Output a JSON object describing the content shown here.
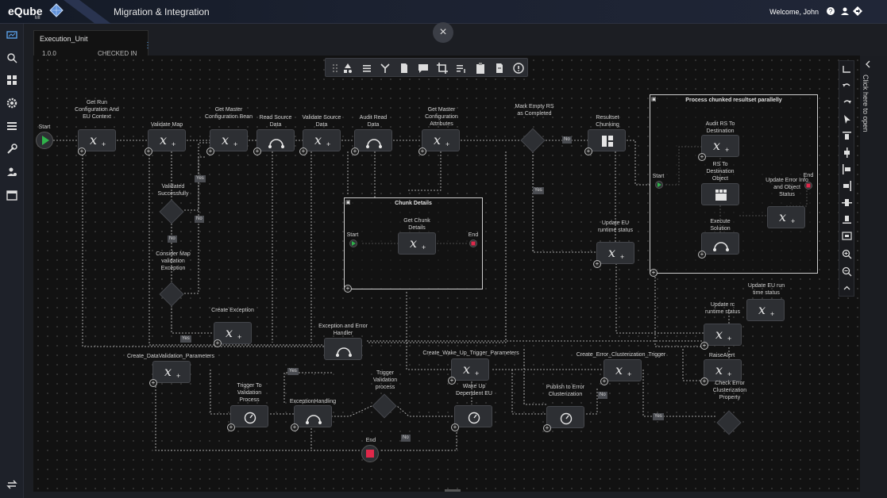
{
  "app": {
    "logo": "eQube",
    "logo_sub": "MI",
    "title": "Migration & Integration",
    "welcome": "Welcome, John"
  },
  "tab": {
    "title": "Execution_Unit",
    "version": "1.0.0",
    "status": "CHECKED IN"
  },
  "side_panel": {
    "label": "Click here to open"
  },
  "close_label": "×",
  "nodes": {
    "start": "Start",
    "get_run_config": "Get Run Configuration And EU Context",
    "validate_map": "Validate Map",
    "get_master_bean": "Get Master Configuration Bean",
    "read_source": "Read Source Data",
    "validate_source": "Validate Source Data",
    "audit_read": "Audit Read Data",
    "get_master_attrs": "Get Master Configuration Attributes",
    "mark_empty": "Mark Empty RS as Completed",
    "resultset_chunking": "Resultset Chunking",
    "validated_successfully": "Validated Successfully",
    "consider_map": "Consider Map validation Exception",
    "create_exception": "Create Exception",
    "exception_handler": "Exception and Error Handler",
    "update_eu_runtime": "Update EU runtime status",
    "create_data_validation": "Create_DataValidation_Parameters",
    "create_wake_up": "Create_Wake_Up_Trigger_Parameters",
    "create_error_cluster": "Create_Error_Clusterization_Trigger",
    "trigger_validation": "Trigger Validation process",
    "trigger_to_validation": "Trigger To Validation Process",
    "exception_handling": "ExceptionHandling",
    "wake_up": "Wake Up Dependent EU",
    "publish_error": "Publish to Error Clusterization",
    "end": "End",
    "update_eu_run_time": "Update EU run time status",
    "update_rc": "Update rc runtime status",
    "raise_alert": "RaiseAlert",
    "check_error": "Check Error Clusterization Property"
  },
  "chunk_group": {
    "title": "Chunk Details",
    "start": "Start",
    "node": "Get Chunk Details",
    "end": "End"
  },
  "process_group": {
    "title": "Process chunked resultset parallelly",
    "start": "Start",
    "audit_rs": "Audit RS To Destination",
    "rs_to_dest": "RS To Destination Object",
    "execute_solution": "Execute Solution",
    "update_error": "Update Error Info and Object Status",
    "end": "End"
  },
  "tags": {
    "yes": "Yes",
    "no": "No"
  },
  "colors": {
    "canvas": "#121212",
    "node": "#2d2f33",
    "start": "#2fb34a",
    "end": "#e0284a",
    "accent": "#5aa0e8"
  }
}
